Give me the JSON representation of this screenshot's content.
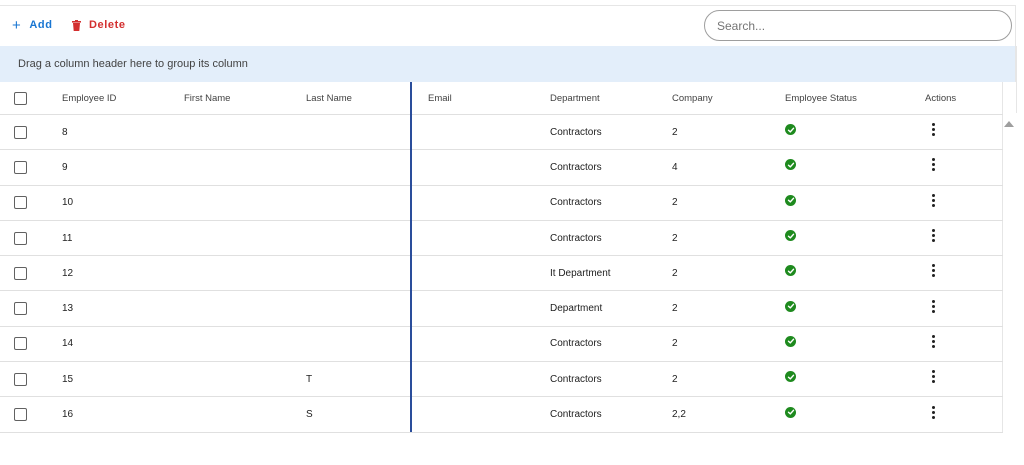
{
  "toolbar": {
    "add_label": "Add",
    "delete_label": "Delete",
    "search_placeholder": "Search..."
  },
  "group_bar": {
    "text": "Drag a column header here to group its column"
  },
  "grid": {
    "columns": [
      "Employee ID",
      "First Name",
      "Last Name",
      "Email",
      "Department",
      "Company",
      "Employee Status",
      "Actions"
    ],
    "rows": [
      {
        "id": "8",
        "first_name": "",
        "last_name": "",
        "email": "",
        "department": "Contractors",
        "company": "2",
        "status": "active"
      },
      {
        "id": "9",
        "first_name": "",
        "last_name": "",
        "email": "",
        "department": "Contractors",
        "company": "4",
        "status": "active"
      },
      {
        "id": "10",
        "first_name": "",
        "last_name": "",
        "email": "",
        "department": "Contractors",
        "company": "2",
        "status": "active"
      },
      {
        "id": "11",
        "first_name": "",
        "last_name": "",
        "email": "",
        "department": "Contractors",
        "company": "2",
        "status": "active"
      },
      {
        "id": "12",
        "first_name": "",
        "last_name": "",
        "email": "",
        "department": "It Department",
        "company": "2",
        "status": "active"
      },
      {
        "id": "13",
        "first_name": "",
        "last_name": "",
        "email": "",
        "department": "Department",
        "company": "2",
        "status": "active"
      },
      {
        "id": "14",
        "first_name": "",
        "last_name": "",
        "email": "",
        "department": "Contractors",
        "company": "2",
        "status": "active"
      },
      {
        "id": "15",
        "first_name": "",
        "last_name": "T",
        "email": "",
        "department": "Contractors",
        "company": "2",
        "status": "active"
      },
      {
        "id": "16",
        "first_name": "",
        "last_name": "S",
        "email": "",
        "department": "Contractors",
        "company": "2,2",
        "status": "active"
      }
    ]
  },
  "icons": {
    "add": "plus-icon",
    "delete": "trash-icon",
    "status": "check-circle-icon",
    "actions": "more-vertical-icon",
    "scroll": "scroll-up-arrow-icon"
  },
  "colors": {
    "add": "#1976d2",
    "delete": "#d32f2f",
    "status_ok": "#1e8a1e",
    "group_bar_bg": "#e3eefa",
    "drag_indicator": "#2a4d9b"
  }
}
